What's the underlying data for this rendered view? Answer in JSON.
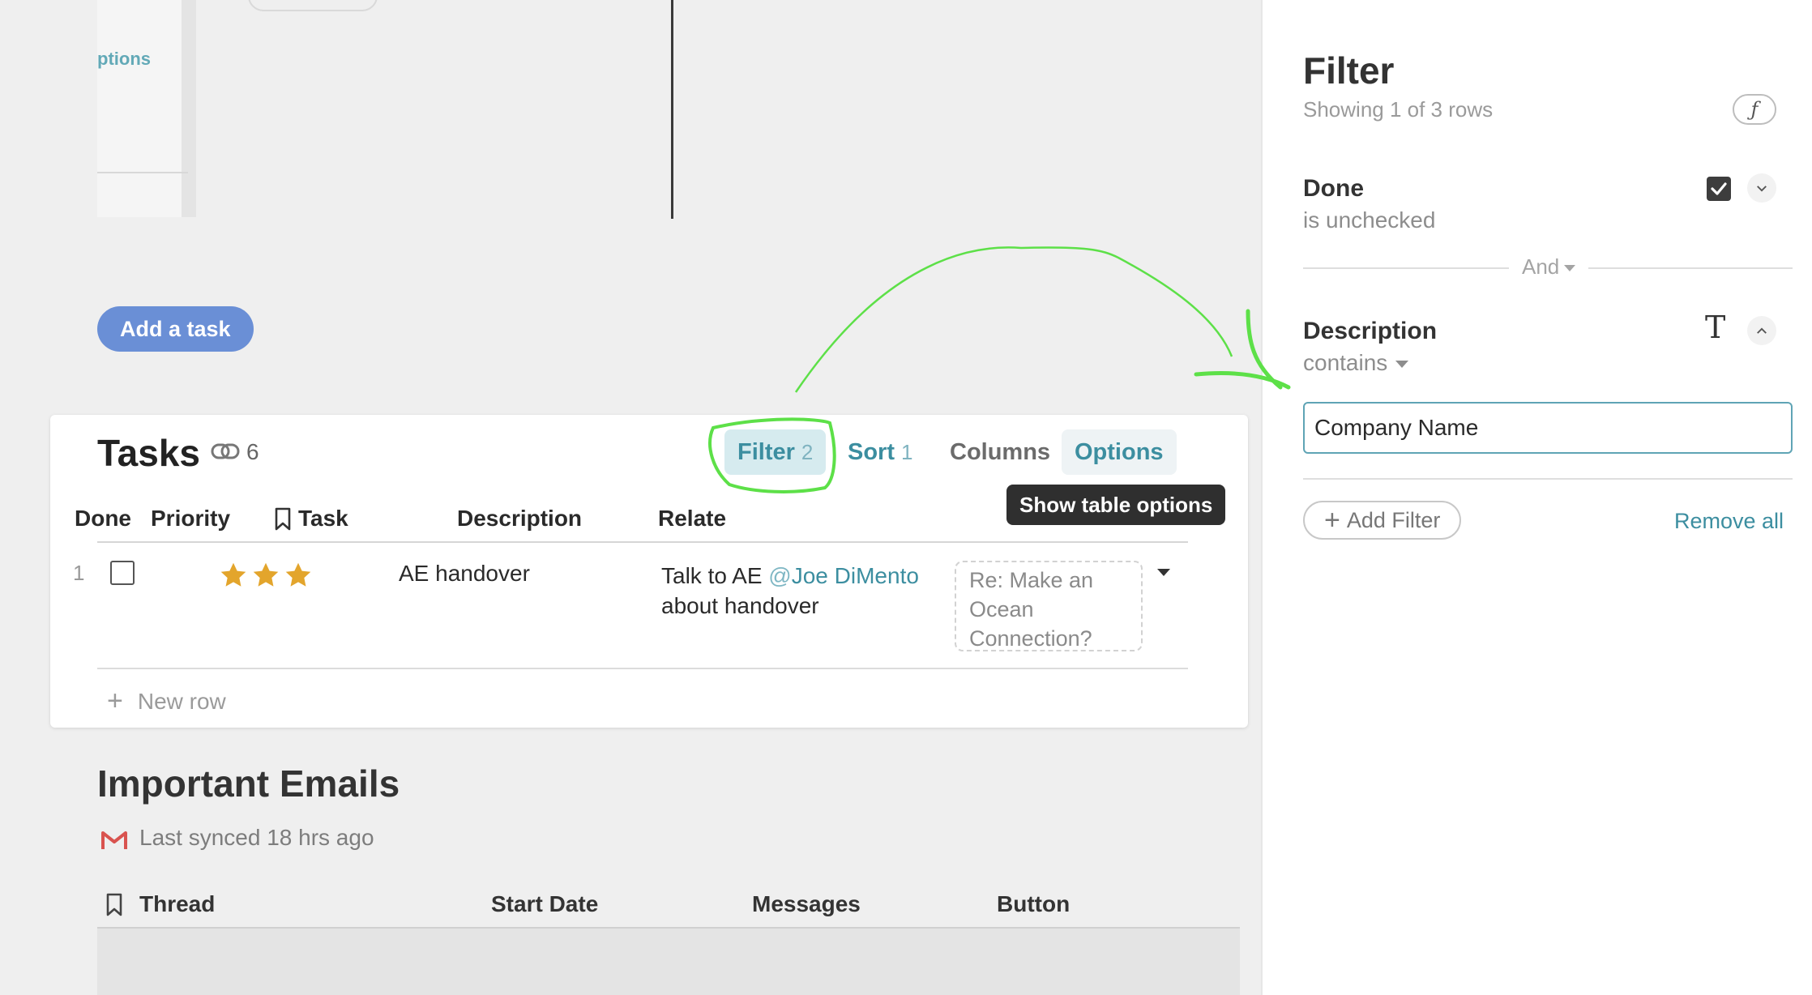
{
  "top": {
    "options_label": "ptions"
  },
  "add_task": {
    "label": "Add a task"
  },
  "tasks": {
    "title": "Tasks",
    "count": "6",
    "toolbar": {
      "filter_label": "Filter",
      "filter_count": "2",
      "sort_label": "Sort",
      "sort_count": "1",
      "columns_label": "Columns",
      "options_label": "Options"
    },
    "tooltip": "Show table options",
    "columns": [
      "Done",
      "Priority",
      "Task",
      "Description",
      "Relate"
    ],
    "rows": [
      {
        "num": "1",
        "priority_stars": 3,
        "task": "AE handover",
        "desc_prefix": "Talk to AE ",
        "mention": "Joe DiMento",
        "desc_suffix": "about handover",
        "related": "Re: Make an Ocean Connection?"
      }
    ],
    "new_row": "New row"
  },
  "emails": {
    "title": "Important Emails",
    "synced": "Last synced 18 hrs ago",
    "columns": [
      "Thread",
      "Start Date",
      "Messages",
      "Button"
    ]
  },
  "panel": {
    "title": "Filter",
    "subtitle": "Showing 1 of 3 rows",
    "formula_label": "ƒ",
    "filters": [
      {
        "field": "Done",
        "condition": "is unchecked"
      },
      {
        "field": "Description",
        "condition": "contains",
        "value": "Company Name"
      }
    ],
    "conjunction": "And",
    "add_filter": "Add Filter",
    "remove_all": "Remove all"
  },
  "colors": {
    "accent": "#3c8ea0",
    "primary_button": "#6a8fd6",
    "star": "#e3a52c",
    "annotation": "#5de048"
  }
}
